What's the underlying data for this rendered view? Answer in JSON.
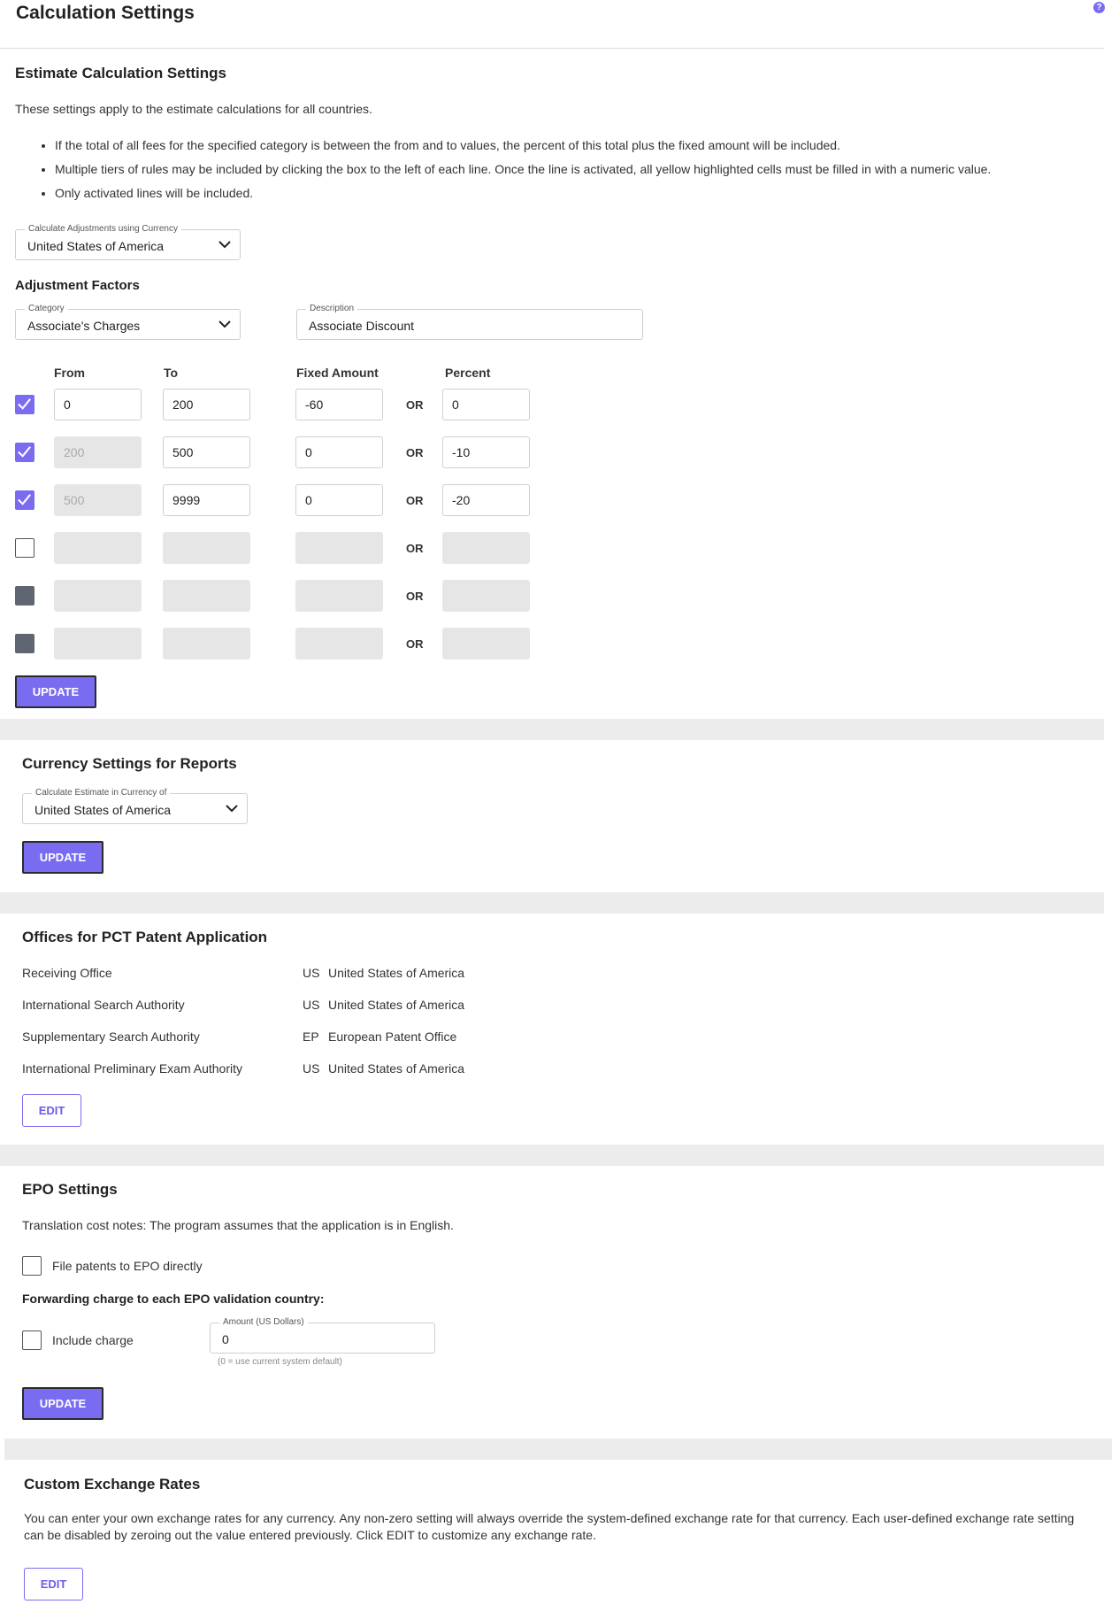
{
  "page": {
    "title": "Calculation Settings"
  },
  "estimate": {
    "heading": "Estimate Calculation Settings",
    "intro": "These settings apply to the estimate calculations for all countries.",
    "bullets": [
      "If the total of all fees for the specified category is between the from and to values, the percent of this total plus the fixed amount will be included.",
      "Multiple tiers of rules may be included by clicking the box to the left of each line. Once the line is activated, all yellow highlighted cells must be filled in with a numeric value.",
      "Only activated lines will be included."
    ],
    "currency_label": "Calculate Adjustments using Currency",
    "currency_value": "United States of America",
    "factors_heading": "Adjustment Factors",
    "category_label": "Category",
    "category_value": "Associate's Charges",
    "description_label": "Description",
    "description_value": "Associate Discount",
    "columns": {
      "from": "From",
      "to": "To",
      "fixed": "Fixed Amount",
      "percent": "Percent"
    },
    "or_label": "OR",
    "rows": [
      {
        "state": "checked",
        "from": "0",
        "to": "200",
        "fixed": "-60",
        "percent": "0"
      },
      {
        "state": "checked",
        "from": "200",
        "to": "500",
        "fixed": "0",
        "percent": "-10"
      },
      {
        "state": "checked",
        "from": "500",
        "to": "9999",
        "fixed": "0",
        "percent": "-20"
      },
      {
        "state": "unchecked",
        "from": "",
        "to": "",
        "fixed": "",
        "percent": ""
      },
      {
        "state": "filled",
        "from": "",
        "to": "",
        "fixed": "",
        "percent": ""
      },
      {
        "state": "filled",
        "from": "",
        "to": "",
        "fixed": "",
        "percent": ""
      }
    ],
    "update_label": "UPDATE"
  },
  "currency_reports": {
    "heading": "Currency Settings for Reports",
    "label": "Calculate Estimate in Currency of",
    "value": "United States of America",
    "update_label": "UPDATE"
  },
  "pct_offices": {
    "heading": "Offices for PCT Patent Application",
    "rows": [
      {
        "label": "Receiving Office",
        "code": "US",
        "name": "United States of America"
      },
      {
        "label": "International Search Authority",
        "code": "US",
        "name": "United States of America"
      },
      {
        "label": "Supplementary Search Authority",
        "code": "EP",
        "name": "European Patent Office"
      },
      {
        "label": "International Preliminary Exam Authority",
        "code": "US",
        "name": "United States of America"
      }
    ],
    "edit_label": "EDIT"
  },
  "epo": {
    "heading": "EPO Settings",
    "note": "Translation cost notes: The program assumes that the application is in English.",
    "file_direct_label": "File patents to EPO directly",
    "forwarding_heading": "Forwarding charge to each EPO validation country:",
    "include_charge_label": "Include charge",
    "amount_label": "Amount (US Dollars)",
    "amount_value": "0",
    "amount_hint": "(0 = use current system default)",
    "update_label": "UPDATE"
  },
  "exchange": {
    "heading": "Custom Exchange Rates",
    "text": "You can enter your own exchange rates for any currency. Any non-zero setting will always override the system-defined exchange rate for that currency. Each user-defined exchange rate setting can be disabled by zeroing out the value entered previously. Click EDIT to customize any exchange rate.",
    "edit_label": "EDIT"
  },
  "colors": {
    "accent": "#7a6cf0",
    "band": "#ececec",
    "disabled_field": "#e6e6e6"
  }
}
